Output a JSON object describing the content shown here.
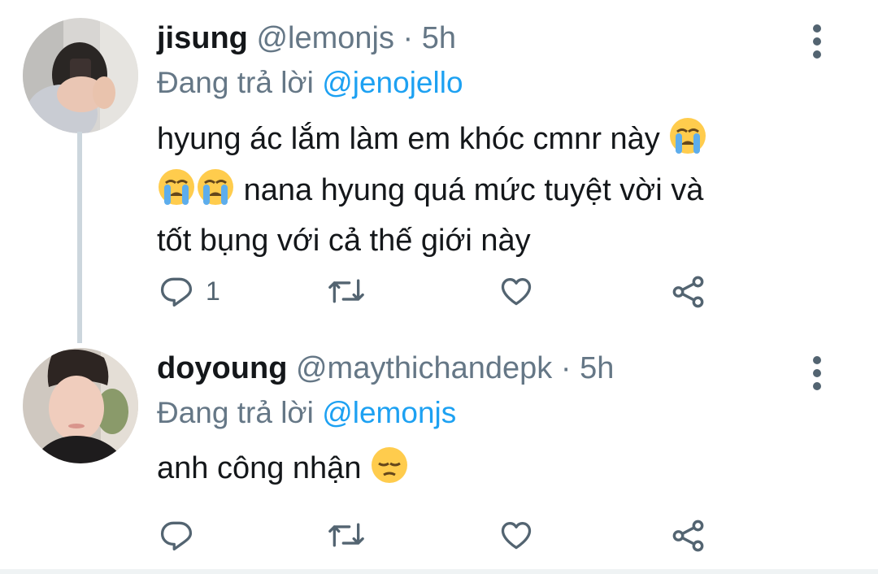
{
  "tweets": [
    {
      "name": "jisung",
      "handle": "@lemonjs",
      "separator": "·",
      "time": "5h",
      "replying_prefix": "Đang trả lời",
      "replying_to": "@jenojello",
      "text_line1": "hyung ác lắm làm em khóc cmnr này",
      "text_line2": "nana hyung quá mức tuyệt vời và",
      "text_line3": "tốt bụng với cả thế giới này",
      "reply_count": "1",
      "emoji": "loudly-crying-face"
    },
    {
      "name": "doyoung",
      "handle": "@maythichandepk",
      "separator": "·",
      "time": "5h",
      "replying_prefix": "Đang trả lời",
      "replying_to": "@lemonjs",
      "text": "anh công nhận",
      "reply_count": "",
      "emoji": "pensive-face"
    }
  ],
  "icons": [
    "reply-icon",
    "retweet-icon",
    "like-icon",
    "share-icon",
    "more-options-icon"
  ],
  "colors": {
    "mention": "#1da1f2",
    "secondary": "#657786",
    "text": "#14171a",
    "thread_line": "#ccd6dd"
  }
}
